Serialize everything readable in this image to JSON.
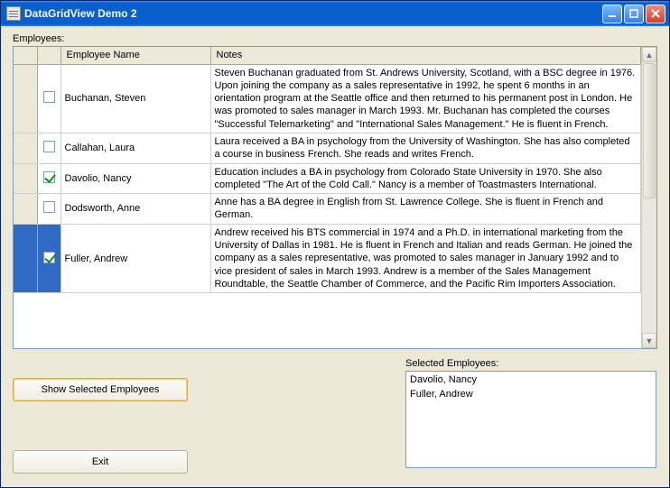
{
  "window": {
    "title": "DataGridView Demo 2"
  },
  "labels": {
    "employees": "Employees:",
    "selected": "Selected Employees:"
  },
  "grid": {
    "headers": {
      "checkbox": "",
      "name": "Employee Name",
      "notes": "Notes"
    },
    "rows": [
      {
        "checked": false,
        "selected": false,
        "name": "Buchanan, Steven",
        "notes": "Steven Buchanan graduated from St. Andrews University, Scotland, with a BSC degree in 1976.  Upon joining the company as a sales representative in 1992, he spent 6 months in an orientation program at the Seattle office and then returned to his permanent post in London.  He was promoted to sales manager in March 1993.  Mr. Buchanan has completed the courses \"Successful Telemarketing\" and \"International Sales Management.\"  He is fluent in French."
      },
      {
        "checked": false,
        "selected": false,
        "name": "Callahan, Laura",
        "notes": "Laura received a BA in psychology from the University of Washington.  She has also completed a course in business French.  She reads and writes French."
      },
      {
        "checked": true,
        "selected": false,
        "name": "Davolio, Nancy",
        "notes": "Education includes a BA in psychology from Colorado State University in 1970.  She also completed \"The Art of the Cold Call.\"  Nancy is a member of Toastmasters International."
      },
      {
        "checked": false,
        "selected": false,
        "name": "Dodsworth, Anne",
        "notes": "Anne has a BA degree in English from St. Lawrence College.  She is fluent in French and German."
      },
      {
        "checked": true,
        "selected": true,
        "name": "Fuller, Andrew",
        "notes": "Andrew received his BTS commercial in 1974 and a Ph.D. in international marketing from the University of Dallas in 1981.  He is fluent in French and Italian and reads German.  He joined the company as a sales representative, was promoted to sales manager in January 1992 and to vice president of sales in March 1993.  Andrew is a member of the Sales Management Roundtable, the Seattle Chamber of Commerce, and the Pacific Rim Importers Association."
      }
    ]
  },
  "buttons": {
    "show_selected": "Show Selected Employees",
    "exit": "Exit"
  },
  "selected_list": [
    "Davolio, Nancy",
    "Fuller, Andrew"
  ]
}
